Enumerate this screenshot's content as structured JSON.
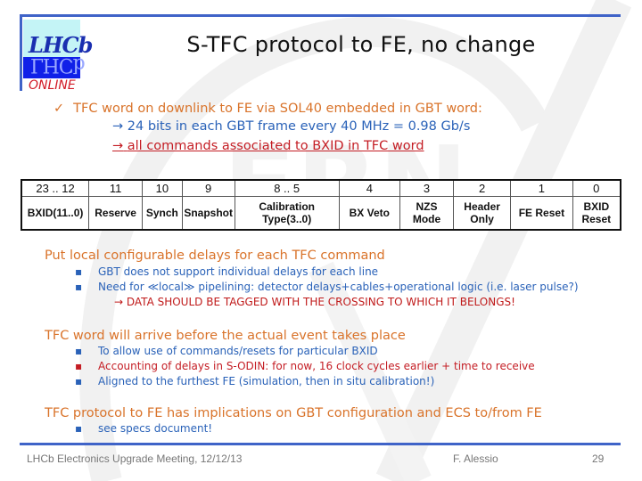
{
  "slide": {
    "title": "S-TFC protocol to FE, no change",
    "logo": {
      "top_text": "LHCb",
      "mirror_text": "LHCb",
      "bottom_text": "ONLINE"
    },
    "intro": {
      "check_icon": "✓",
      "heading": "TFC word on downlink to FE via SOL40 embedded in GBT word:",
      "arrow_icon": "→",
      "sub1": "24 bits in each GBT frame every 40 MHz = 0.98 Gb/s",
      "sub2": "all commands associated to BXID in TFC word"
    },
    "bit_table": {
      "headers": [
        "23 .. 12",
        "11",
        "10",
        "9",
        "8 .. 5",
        "4",
        "3",
        "2",
        "1",
        "0"
      ],
      "labels": [
        "BXID(11..0)",
        "Reserve",
        "Synch",
        "Snapshot",
        "Calibration Type(3..0)",
        "BX Veto",
        "NZS\nMode",
        "Header\nOnly",
        "FE Reset",
        "BXID\nReset"
      ]
    },
    "sections": [
      {
        "heading": "Put local configurable delays for each TFC command",
        "bullets": [
          {
            "text": "GBT does not support individual delays for each line",
            "color": "blue"
          },
          {
            "text": "Need for ≪local≫ pipelining: detector delays+cables+operational logic (i.e. laser pulse?)",
            "color": "blue"
          }
        ],
        "note": "→  DATA SHOULD BE TAGGED WITH THE CROSSING TO WHICH IT BELONGS!"
      },
      {
        "heading": "TFC word will arrive before the actual event takes place",
        "bullets": [
          {
            "text": "To allow use of commands/resets for particular BXID",
            "color": "blue"
          },
          {
            "text": "Accounting of delays in S-ODIN: for now, 16 clock cycles earlier + time to receive",
            "color": "red"
          },
          {
            "text": "Aligned to the furthest FE (simulation, then in situ calibration!)",
            "color": "blue"
          }
        ]
      },
      {
        "heading": "TFC protocol to FE has implications on GBT configuration and ECS to/from FE",
        "bullets": [
          {
            "text": "see specs document!",
            "color": "blue"
          }
        ]
      }
    ],
    "bullet_glyph": "▪",
    "footer": {
      "left": "LHCb Electronics Upgrade Meeting, 12/12/13",
      "center": "F. Alessio",
      "page": "29"
    },
    "colors": {
      "accent_rule": "#3f63c8",
      "heading_orange": "#d9732a",
      "text_blue": "#2a62b8",
      "text_red": "#c41d24"
    }
  }
}
